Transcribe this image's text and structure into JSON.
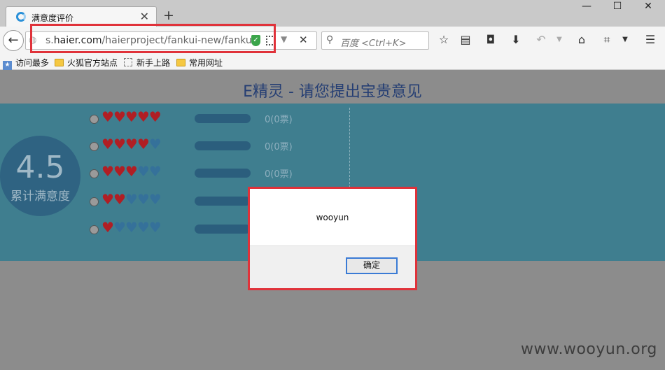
{
  "browser": {
    "tab_title": "满意度评价",
    "window_controls": {
      "minimize": "—",
      "maximize": "☐",
      "close": "✕"
    },
    "url_prefix": "s.",
    "url_host": "haier.com",
    "url_path": "/haierproject/fankui-new/fankui",
    "search_placeholder": "百度 <Ctrl+K>",
    "bookmarks": [
      "访问最多",
      "火狐官方站点",
      "新手上路",
      "常用网址"
    ],
    "icons": [
      "back-arrow-icon",
      "globe-icon",
      "shield-icon",
      "qr-code-icon",
      "dropdown-icon",
      "stop-icon",
      "search-icon",
      "star-icon",
      "reading-list-icon",
      "pocket-icon",
      "download-icon",
      "undo-icon",
      "home-icon",
      "crop-icon",
      "menu-icon"
    ]
  },
  "page": {
    "title": "E精灵 - 请您提出宝贵意见",
    "score": "4.5",
    "score_label": "累计满意度",
    "ratings": [
      {
        "stars": 5,
        "count": "0(0票)"
      },
      {
        "stars": 4,
        "count": "0(0票)"
      },
      {
        "stars": 3,
        "count": "0(0票)"
      },
      {
        "stars": 2,
        "count": ""
      },
      {
        "stars": 1,
        "count": ""
      }
    ],
    "colors": {
      "panel": "#3f7e8f",
      "heart_red": "#b01e24",
      "heart_blue": "#35719a",
      "title": "#253e73",
      "highlight": "#e0323a"
    }
  },
  "dialog": {
    "message": "wooyun",
    "ok_label": "确定"
  },
  "watermark": "www.wooyun.org"
}
